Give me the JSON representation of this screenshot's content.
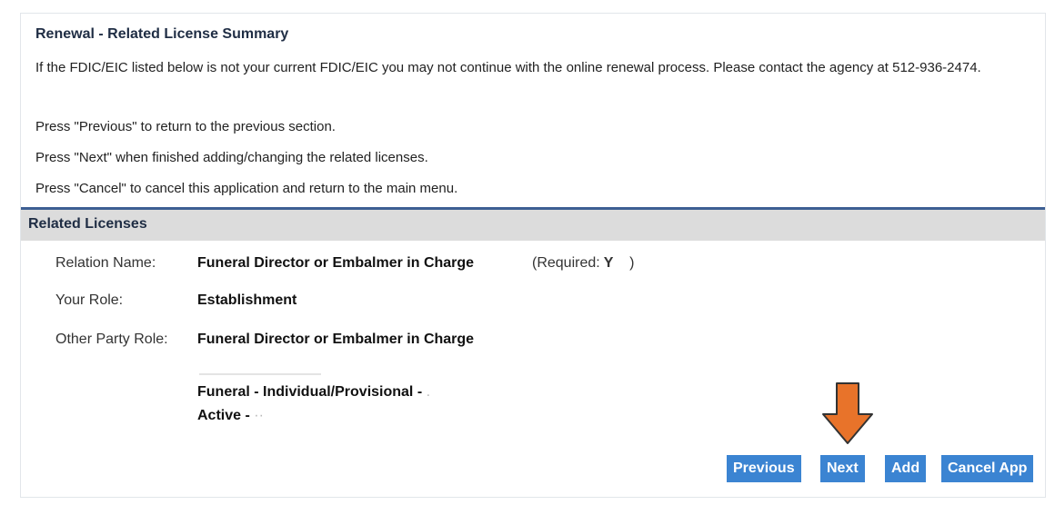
{
  "summary": {
    "title": "Renewal - Related License Summary",
    "notice": "If the FDIC/EIC listed below is not your current FDIC/EIC you may not continue with the online renewal process. Please contact the agency at 512-936-2474.",
    "instr_previous": "Press \"Previous\" to return to the previous section.",
    "instr_next": "Press \"Next\" when finished adding/changing the related licenses.",
    "instr_cancel": "Press \"Cancel\" to cancel this application and return to the main menu."
  },
  "related": {
    "header": "Related Licenses",
    "relation_label": "Relation Name:",
    "relation_value": "Funeral Director or Embalmer in Charge",
    "required_label": "(Required:",
    "required_value": "Y",
    "required_close": ")",
    "role_label": "Your Role:",
    "role_value": "Establishment",
    "other_label": "Other Party Role:",
    "other_value": "Funeral Director or Embalmer in Charge",
    "license_type": "Funeral - Individual/Provisional - ",
    "license_status": "Active - "
  },
  "buttons": {
    "previous": "Previous",
    "next": "Next",
    "add": "Add",
    "cancel_app": "Cancel App"
  },
  "colors": {
    "button_blue": "#3b84d2",
    "rule_blue": "#3d5f93",
    "arrow_orange": "#e8732a"
  }
}
